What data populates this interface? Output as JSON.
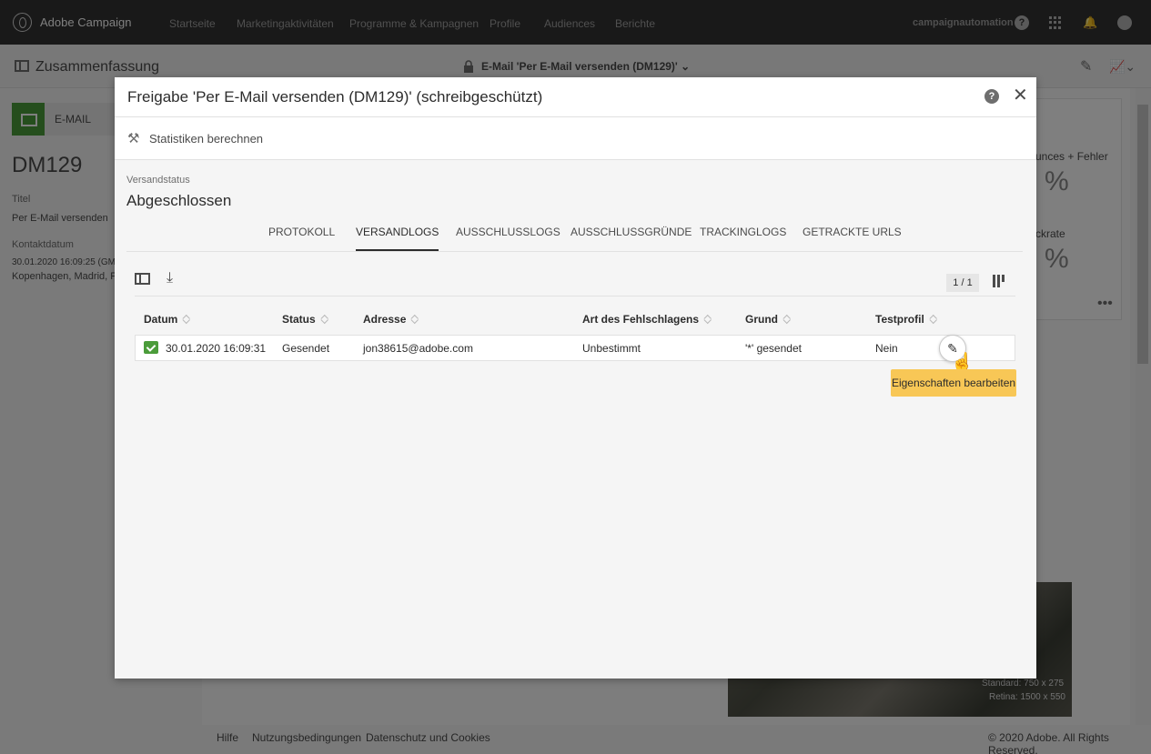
{
  "app": {
    "brand": "Adobe Campaign",
    "nav": [
      "Startseite",
      "Marketingaktivitäten",
      "Programme & Kampagnen",
      "Profile",
      "Audiences",
      "Berichte"
    ],
    "user": "campaignautomation"
  },
  "header": {
    "title": "Zusammenfassung",
    "document": "E-Mail 'Per E-Mail versenden (DM129)'"
  },
  "background": {
    "email_label": "E-MAIL",
    "code": "DM129",
    "title_label": "Titel",
    "title_value": "Per E-Mail versenden",
    "contact_label": "Kontaktdatum",
    "contact_value_1": "30.01.2020 16:09:25 (GM",
    "contact_value_2": "Kopenhagen, Madrid, Pa",
    "kpi_1_label": "unces + Fehler",
    "kpi_1_value": "%",
    "kpi_2_label": "ckrate",
    "kpi_2_value": "%",
    "image_note_1": "Standard: 750 x 275",
    "image_note_2": "Retina: 1500 x 550",
    "footer_links": [
      "Hilfe",
      "Nutzungsbedingungen",
      "Datenschutz und Cookies"
    ],
    "copyright": "© 2020 Adobe. All Rights Reserved."
  },
  "dialog": {
    "title": "Freigabe 'Per E-Mail versenden (DM129)' (schreibgeschützt)",
    "compute_stats": "Statistiken berechnen",
    "status_label": "Versandstatus",
    "status_value": "Abgeschlossen",
    "tabs": [
      "PROTOKOLL",
      "VERSANDLOGS",
      "AUSSCHLUSSLOGS",
      "AUSSCHLUSSGRÜNDE",
      "TRACKINGLOGS",
      "GETRACKTE URLS"
    ],
    "active_tab": "VERSANDLOGS",
    "pager": "1 / 1",
    "columns": [
      "Datum",
      "Status",
      "Adresse",
      "Art des Fehlschlagens",
      "Grund",
      "Testprofil"
    ],
    "rows": [
      {
        "datum": "30.01.2020 16:09:31",
        "status": "Gesendet",
        "adresse": "jon38615@adobe.com",
        "art": "Unbestimmt",
        "grund": "'*' gesendet",
        "testprofil": "Nein"
      }
    ],
    "tooltip": "Eigenschaften bearbeiten"
  },
  "colors": {
    "topbar": "#323232",
    "success_green": "#4b9c3a",
    "tooltip_yellow": "#f8c756"
  },
  "icons": [
    "logo-icon",
    "help-icon",
    "apps-grid-icon",
    "bell-icon",
    "avatar-icon",
    "summary-panel-icon",
    "lock-icon",
    "pencil-icon",
    "chart-icon",
    "chevron-down-icon",
    "close-icon",
    "wand-icon",
    "sidebar-toggle-icon",
    "download-icon",
    "column-settings-icon",
    "sort-icon",
    "check-icon",
    "cursor-hand-icon"
  ]
}
